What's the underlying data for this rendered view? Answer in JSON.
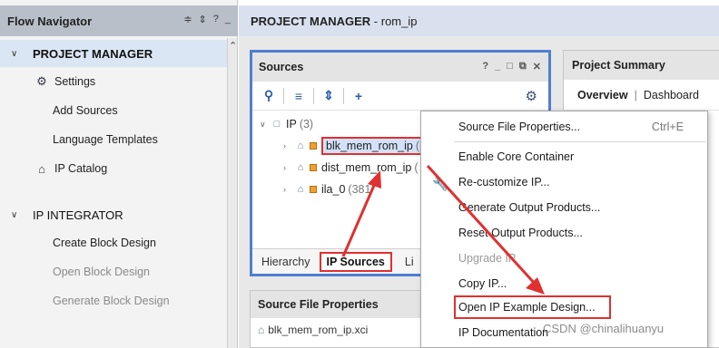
{
  "flow_navigator": {
    "title": "Flow Navigator",
    "tools": [
      "≑",
      "⇕",
      "?",
      "_"
    ],
    "sections": [
      {
        "label": "PROJECT MANAGER",
        "expanded": true,
        "active": true,
        "items": [
          {
            "label": "Settings",
            "icon": "gear-icon",
            "enabled": true
          },
          {
            "label": "Add Sources",
            "enabled": true
          },
          {
            "label": "Language Templates",
            "enabled": true
          },
          {
            "label": "IP Catalog",
            "icon": "ip-catalog-icon",
            "enabled": true
          }
        ]
      },
      {
        "label": "IP INTEGRATOR",
        "expanded": true,
        "active": false,
        "items": [
          {
            "label": "Create Block Design",
            "enabled": true
          },
          {
            "label": "Open Block Design",
            "enabled": false
          },
          {
            "label": "Generate Block Design",
            "enabled": false
          }
        ]
      }
    ]
  },
  "main_header": {
    "prefix": "PROJECT MANAGER",
    "suffix": " - rom_ip"
  },
  "sources": {
    "title": "Sources",
    "window_tools": [
      "?",
      "_",
      "□",
      "⧉",
      "✕"
    ],
    "toolbar": [
      "search-icon",
      "collapse-all-icon",
      "expand-all-icon",
      "add-icon",
      "gear-icon"
    ],
    "tree": {
      "root": {
        "label": "IP",
        "count": "(3)"
      },
      "children": [
        {
          "label": "blk_mem_rom_ip",
          "count": "(1",
          "highlighted": true
        },
        {
          "label": "dist_mem_rom_ip",
          "count": "(",
          "highlighted": false
        },
        {
          "label": "ila_0",
          "count": "(381",
          "highlighted": false
        }
      ]
    },
    "tabs": [
      "Hierarchy",
      "IP Sources",
      "Li"
    ],
    "active_tab": "IP Sources"
  },
  "source_file_properties": {
    "title": "Source File Properties",
    "file": "blk_mem_rom_ip.xci"
  },
  "project_summary": {
    "title": "Project Summary",
    "tabs": [
      "Overview",
      "Dashboard"
    ],
    "active_tab": "Overview"
  },
  "context_menu": {
    "items": [
      {
        "label": "Source File Properties...",
        "shortcut": "Ctrl+E",
        "enabled": true
      },
      {
        "label": "Enable Core Container",
        "enabled": true
      },
      {
        "label": "Re-customize IP...",
        "enabled": true
      },
      {
        "label": "Generate Output Products...",
        "enabled": true
      },
      {
        "label": "Reset Output Products...",
        "enabled": true
      },
      {
        "label": "Upgrade IP",
        "enabled": false
      },
      {
        "label": "Copy IP...",
        "enabled": true
      },
      {
        "label": "Open IP Example Design...",
        "enabled": true,
        "highlighted": true
      },
      {
        "label": "IP Documentation",
        "enabled": true
      }
    ]
  },
  "watermark": "CSDN @chinalihuanyu",
  "colors": {
    "highlight_red": "#e03030",
    "panel_focus_blue": "#4f7fd2",
    "selection_blue": "#d3e1f8",
    "header_gray": "#b9bfc9"
  }
}
